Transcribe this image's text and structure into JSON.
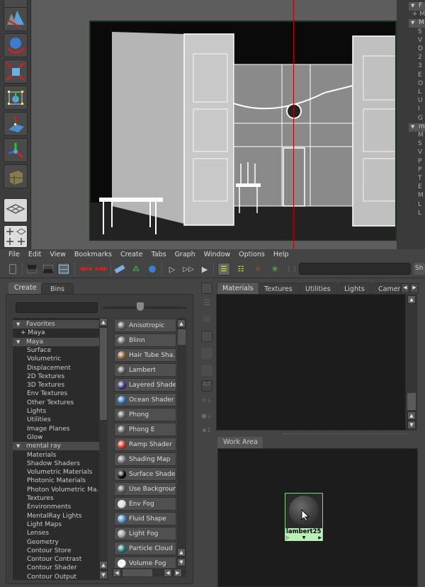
{
  "shelf": {
    "tools": [
      {
        "icon": "move-cone-icon"
      },
      {
        "icon": "rotate-sphere-icon"
      },
      {
        "icon": "scale-cube-icon"
      },
      {
        "icon": "universal-manipulator-icon"
      },
      {
        "icon": "soft-modification-icon"
      },
      {
        "icon": "axis-manipulator-icon"
      },
      {
        "icon": "cube-grid-icon"
      }
    ],
    "layout_buttons": [
      "single-perspective-layout-icon",
      "four-view-layout-icon"
    ]
  },
  "right_strip": {
    "lines": [
      "F",
      "+ M",
      "M",
      "S",
      "V",
      "D",
      "2",
      "3",
      "E",
      "O",
      "L",
      "U",
      "I",
      "G",
      "m",
      "M",
      "S",
      "V",
      "P",
      "P",
      "T",
      "E",
      "M",
      "L",
      "L"
    ]
  },
  "menubar": {
    "items": [
      "File",
      "Edit",
      "View",
      "Bookmarks",
      "Create",
      "Tabs",
      "Graph",
      "Window",
      "Options",
      "Help"
    ]
  },
  "toolbar": {
    "show_label": "Sh",
    "search_value": ""
  },
  "create_panel": {
    "tabs": [
      {
        "label": "Create",
        "active": true
      },
      {
        "label": "Bins",
        "active": false
      }
    ],
    "filter_value": "",
    "icon_size_slider": 0.45,
    "tree": [
      {
        "label": "Favorites",
        "type": "header"
      },
      {
        "label": "+ Maya",
        "type": "fav"
      },
      {
        "label": "Maya",
        "type": "header"
      },
      {
        "label": "Surface",
        "type": "item"
      },
      {
        "label": "Volumetric",
        "type": "item"
      },
      {
        "label": "Displacement",
        "type": "item"
      },
      {
        "label": "2D Textures",
        "type": "item"
      },
      {
        "label": "3D Textures",
        "type": "item"
      },
      {
        "label": "Env Textures",
        "type": "item"
      },
      {
        "label": "Other Textures",
        "type": "item"
      },
      {
        "label": "Lights",
        "type": "item"
      },
      {
        "label": "Utilities",
        "type": "item"
      },
      {
        "label": "Image Planes",
        "type": "item"
      },
      {
        "label": "Glow",
        "type": "item"
      },
      {
        "label": "mental ray",
        "type": "header"
      },
      {
        "label": "Materials",
        "type": "item"
      },
      {
        "label": "Shadow Shaders",
        "type": "item"
      },
      {
        "label": "Volumetric Materials",
        "type": "item"
      },
      {
        "label": "Photonic Materials",
        "type": "item"
      },
      {
        "label": "Photon Volumetric Ma...",
        "type": "item"
      },
      {
        "label": "Textures",
        "type": "item"
      },
      {
        "label": "Environments",
        "type": "item"
      },
      {
        "label": "MentalRay Lights",
        "type": "item"
      },
      {
        "label": "Light Maps",
        "type": "item"
      },
      {
        "label": "Lenses",
        "type": "item"
      },
      {
        "label": "Geometry",
        "type": "item"
      },
      {
        "label": "Contour Store",
        "type": "item"
      },
      {
        "label": "Contour Contrast",
        "type": "item"
      },
      {
        "label": "Contour Shader",
        "type": "item"
      },
      {
        "label": "Contour Output",
        "type": "item"
      }
    ],
    "nodes": [
      {
        "label": "Anisotropic",
        "icon": "anisotropic-sphere-icon",
        "color": "#555555"
      },
      {
        "label": "Blinn",
        "icon": "blinn-sphere-icon",
        "color": "#666666"
      },
      {
        "label": "Hair Tube Sha...",
        "icon": "hair-tube-shader-icon",
        "color": "#8a5a2a"
      },
      {
        "label": "Lambert",
        "icon": "lambert-sphere-icon",
        "color": "#555555"
      },
      {
        "label": "Layered Shader",
        "icon": "layered-shader-icon",
        "color": "#303080"
      },
      {
        "label": "Ocean Shader",
        "icon": "ocean-shader-icon",
        "color": "#2a70b8"
      },
      {
        "label": "Phong",
        "icon": "phong-sphere-icon",
        "color": "#5a5a5a"
      },
      {
        "label": "Phong E",
        "icon": "phong-e-sphere-icon",
        "color": "#5a5a5a"
      },
      {
        "label": "Ramp Shader",
        "icon": "ramp-shader-icon",
        "color": "#d03020"
      },
      {
        "label": "Shading Map",
        "icon": "shading-map-icon",
        "color": "#777777"
      },
      {
        "label": "Surface Shader",
        "icon": "surface-shader-icon",
        "color": "#000000"
      },
      {
        "label": "Use Background",
        "icon": "use-background-icon",
        "color": "#555555"
      },
      {
        "label": "Env Fog",
        "icon": "env-fog-icon",
        "color": "#dddddd"
      },
      {
        "label": "Fluid Shape",
        "icon": "fluid-shape-icon",
        "color": "#4a90d0"
      },
      {
        "label": "Light Fog",
        "icon": "light-fog-icon",
        "color": "#999999"
      },
      {
        "label": "Particle Cloud",
        "icon": "particle-cloud-icon",
        "color": "#1a7070"
      },
      {
        "label": "Volume Fog",
        "icon": "volume-fog-icon",
        "color": "#ffffff"
      }
    ]
  },
  "browser": {
    "tabs": [
      {
        "label": "Materials",
        "active": true
      },
      {
        "label": "Textures",
        "active": false
      },
      {
        "label": "Utilities",
        "active": false
      },
      {
        "label": "Lights",
        "active": false
      },
      {
        "label": "Camer...",
        "active": false
      }
    ]
  },
  "work_area": {
    "tab_label": "Work Area",
    "node": {
      "label": "lambert25"
    }
  },
  "colors": {
    "connector": "#c00000",
    "node_border": "#8fd08f",
    "node_label_bg": "#b8f0b8"
  }
}
